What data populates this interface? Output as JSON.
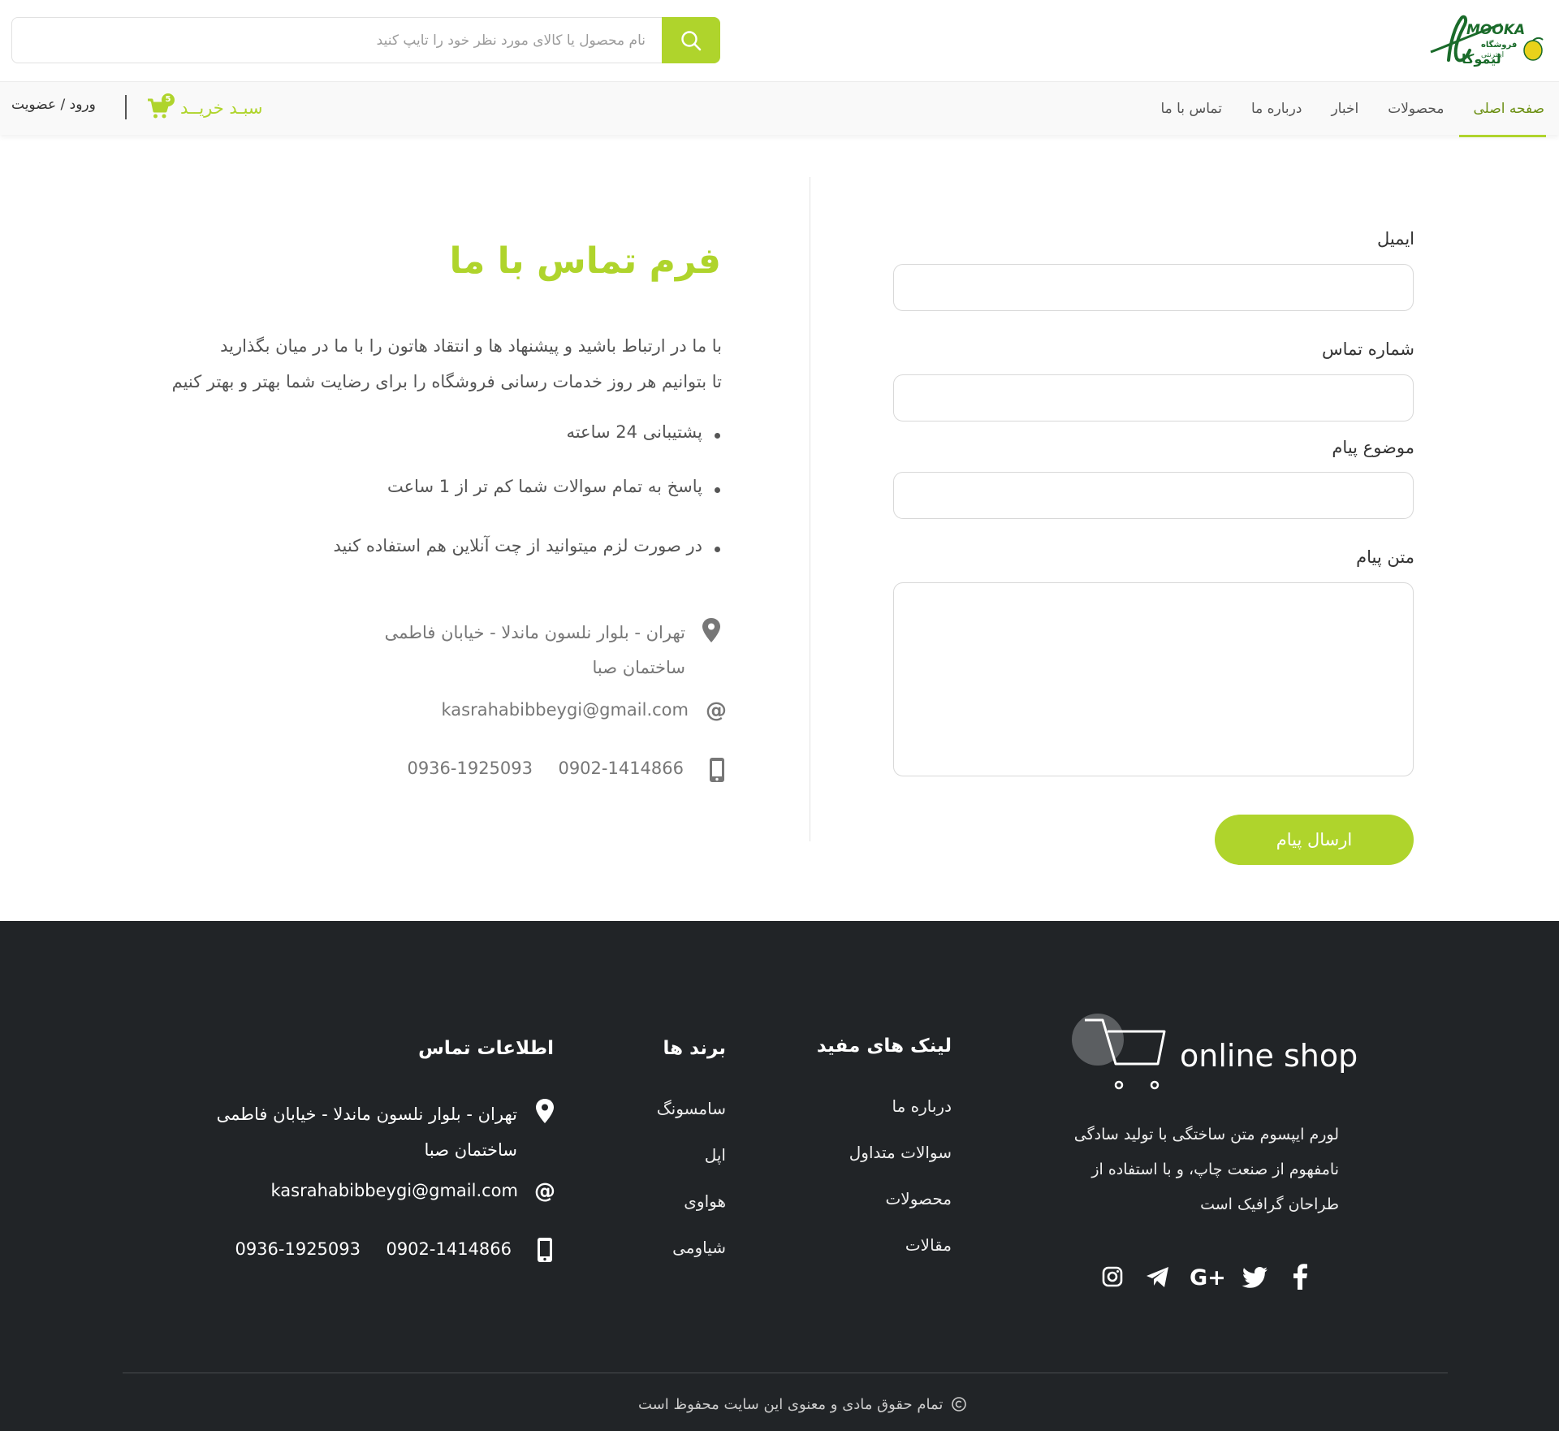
{
  "header": {
    "logo_text": "LIMOOKA فروشگاه اینترنتی لیموکا",
    "search_placeholder": "نام محصول یا کالای مورد نظر خود را تایپ کنید",
    "cart_label": "سبـد خریــد",
    "cart_count": "5",
    "auth_label": "ورود / عضویت"
  },
  "nav": {
    "items": [
      {
        "label": "صفحه اصلی",
        "active": true
      },
      {
        "label": "محصولات",
        "active": false
      },
      {
        "label": "اخبار",
        "active": false
      },
      {
        "label": "درباره ما",
        "active": false
      },
      {
        "label": "تماس با ما",
        "active": false
      }
    ]
  },
  "form": {
    "email_label": "ایمیل",
    "phone_label": "شماره تماس",
    "subject_label": "موضوع پیام",
    "message_label": "متن پیام",
    "send_label": "ارسال پیام"
  },
  "contact": {
    "title": "فرم تماس با ما",
    "intro_line1": "با ما در ارتباط باشید و پیشنهاد ها و انتقاد هاتون را با ما در میان بگذارید",
    "intro_line2": "تا بتوانیم هر روز خدمات رسانی فروشگاه را برای رضایت شما بهتر و بهتر کنیم",
    "bullets": [
      "پشتیبانی 24 ساعته",
      "پاسخ به تمام سوالات شما کم تر از 1 ساعت",
      "در صورت لزم میتوانید از چت آنلاین هم استفاده کنید"
    ],
    "address_line1": "تهران - بلوار نلسون ماندلا - خیابان فاطمی",
    "address_line2": "ساختمان صبا",
    "email": "kasrahabibbeygi@gmail.com",
    "phone1": "0902-1414866",
    "phone2": "0936-1925093"
  },
  "footer": {
    "shop_title": "online shop",
    "desc_line1": "لورم ایپسوم متن ساختگی با تولید سادگی",
    "desc_line2": "نامفهوم از صنعت چاپ، و با استفاده از",
    "desc_line3": "طراحان گرافیک است",
    "social_icons": [
      "facebook-icon",
      "twitter-icon",
      "google-plus-icon",
      "telegram-icon",
      "instagram-icon"
    ],
    "links_title": "لینک های مفید",
    "links": [
      "درباره ما",
      "سوالات متداول",
      "محصولات",
      "مقالات"
    ],
    "brands_title": "برند ها",
    "brands": [
      "سامسونگ",
      "اپل",
      "هواوی",
      "شیاومی"
    ],
    "info_title": "اطلاعات تماس",
    "address_line1": "تهران - بلوار نلسون ماندلا - خیابان فاطمی",
    "address_line2": "ساختمان صبا",
    "email": "kasrahabibbeygi@gmail.com",
    "phone1": "0902-1414866",
    "phone2": "0936-1925093",
    "copyright": "تمام حقوق مادی و معنوی این سایت محفوظ است"
  },
  "colors": {
    "accent": "#afd42c",
    "footer_bg": "#212427",
    "logo_green": "#1a6b2a"
  }
}
